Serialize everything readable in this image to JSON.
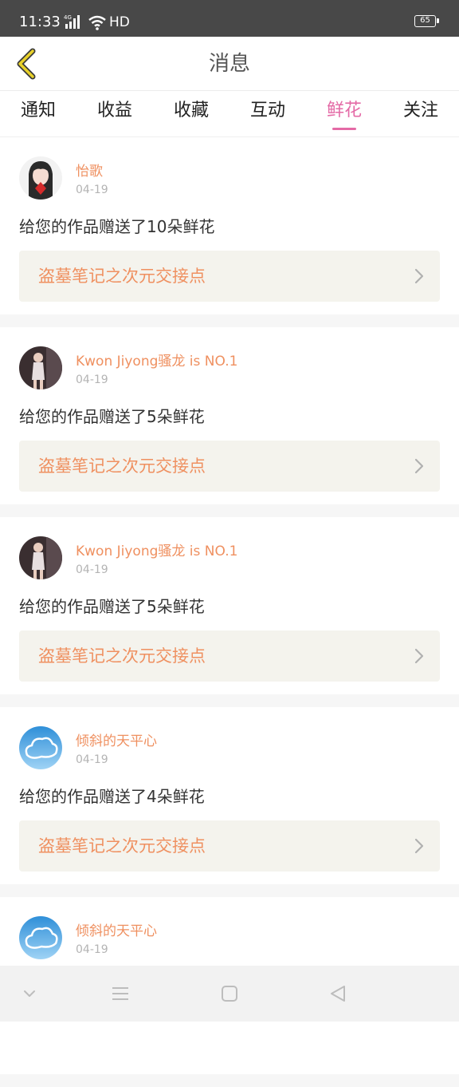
{
  "status_bar": {
    "time": "11:33",
    "network": "4G",
    "wifi_label": "HD",
    "battery": "65"
  },
  "header": {
    "title": "消息"
  },
  "tabs": [
    {
      "label": "通知",
      "active": false
    },
    {
      "label": "收益",
      "active": false
    },
    {
      "label": "收藏",
      "active": false
    },
    {
      "label": "互动",
      "active": false
    },
    {
      "label": "鲜花",
      "active": true
    },
    {
      "label": "关注",
      "active": false
    }
  ],
  "messages": [
    {
      "user": "怡歌",
      "date": "04-19",
      "text": "给您的作品赠送了10朵鲜花",
      "work": "盗墓笔记之次元交接点",
      "avatar": "girl-portrait"
    },
    {
      "user": "Kwon Jiyong骚龙 is NO.1",
      "date": "04-19",
      "text": "给您的作品赠送了5朵鲜花",
      "work": "盗墓笔记之次元交接点",
      "avatar": "person-photo"
    },
    {
      "user": "Kwon Jiyong骚龙 is NO.1",
      "date": "04-19",
      "text": "给您的作品赠送了5朵鲜花",
      "work": "盗墓笔记之次元交接点",
      "avatar": "person-photo"
    },
    {
      "user": "倾斜的天平心",
      "date": "04-19",
      "text": "给您的作品赠送了4朵鲜花",
      "work": "盗墓笔记之次元交接点",
      "avatar": "cloud"
    },
    {
      "user": "倾斜的天平心",
      "date": "04-19",
      "text": "",
      "work": "",
      "avatar": "cloud"
    }
  ],
  "colors": {
    "accent_orange": "#ef9060",
    "active_tab_pink": "#e46aa6",
    "back_yellow": "#e8d12a"
  },
  "system_nav": [
    "chevron-down-icon",
    "menu-icon",
    "home-square-icon",
    "back-triangle-icon"
  ]
}
